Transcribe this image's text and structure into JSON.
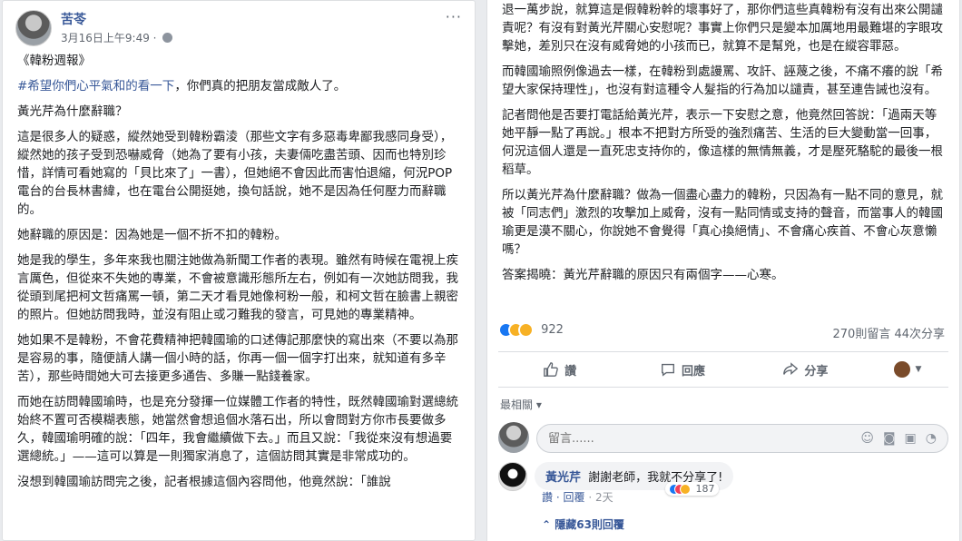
{
  "post": {
    "author": "苦苓",
    "time": "3月16日上午9:49 · ",
    "more": "···"
  },
  "left_paragraphs": [
    "《韓粉週報》",
    "黃光芹為什麼辭職？",
    "這是很多人的疑惑，縱然她受到韓粉霸淩（那些文字有多惡毒卑鄙我感同身受），縱然她的孩子受到恐嚇威脅（她為了要有小孩，夫妻倆吃盡苦頭、因而也特別珍惜，詳情可看她寫的「貝比來了」一書），但她絕不會因此而害怕退縮，何況POP電台的台長林書緯，也在電台公開挺她，換句話說，她不是因為任何壓力而辭職的。",
    "她辭職的原因是：因為她是一個不折不扣的韓粉。",
    "她是我的學生，多年來我也關注她做為新聞工作者的表現。雖然有時候在電視上疾言厲色，但從來不失她的專業，不會被意識形態所左右，例如有一次她訪問我，我從頭到尾把柯文哲痛罵一頓，第二天才看見她像柯粉一般，和柯文哲在臉書上親密的照片。但她訪問我時，並沒有阻止或刁難我的發言，可見她的專業精神。",
    "她如果不是韓粉，不會花費精神把韓國瑜的口述傳記那麼快的寫出來（不要以為那是容易的事，隨便請人講一個小時的話，你再一個一個字打出來，就知道有多辛苦），那些時間她大可去接更多通告、多賺一點錢養家。",
    "而她在訪問韓國瑜時，也是充分發揮一位媒體工作者的特性，既然韓國瑜對選總統始終不置可否模糊表態，她當然會想追個水落石出，所以會問對方你市長要做多久，韓國瑜明確的說：「四年，我會繼續做下去。」而且又說：「我從來沒有想過要選總統。」——這可以算是一則獨家消息了，這個訪問其實是非常成功的。",
    "沒想到韓國瑜訪問完之後，記者根據這個內容問他，他竟然說：「誰說"
  ],
  "hashtag_line": {
    "tag": "#希望你們心平氣和的看一下",
    "rest": "，你們真的把朋友當成敵人了。"
  },
  "right_paragraphs": [
    "退一萬步說，就算這是假韓粉幹的壞事好了，那你們這些真韓粉有沒有出來公開譴責呢？有沒有對黃光芹關心安慰呢？事實上你們只是變本加厲地用最難堪的字眼攻擊她，差別只在沒有威脅她的小孩而已，就算不是幫兇，也是在縱容罪惡。",
    "而韓國瑜照例像過去一樣，在韓粉到處謾罵、攻訐、誣蔑之後，不痛不癢的說「希望大家保持理性」，也沒有對這種令人髮指的行為加以譴責，甚至連告誡也沒有。",
    "記者問他是否要打電話給黃光芹，表示一下安慰之意，他竟然回答說：「過兩天等她平靜一點了再說。」根本不把對方所受的強烈痛苦、生活的巨大變動當一回事，何況這個人還是一直死忠支持你的，像這樣的無情無義，才是壓死駱駝的最後一根稻草。",
    "所以黃光芹為什麼辭職？做為一個盡心盡力的韓粉，只因為有一點不同的意見，就被「同志們」激烈的攻擊加上威脅，沒有一點同情或支持的聲音，而當事人的韓國瑜更是漠不關心，你說她不會覺得「真心換絕情」、不會痛心疾首、不會心灰意懶嗎？",
    "答案揭曉：黃光芹辭職的原因只有兩個字——心寒。"
  ],
  "stats": {
    "reactions_count": "922",
    "comments_shares": "270則留言 44次分享"
  },
  "actions": {
    "like": "讚",
    "comment": "回應",
    "share": "分享"
  },
  "sort_label": "最相關 ▾",
  "compose": {
    "placeholder": "留言......"
  },
  "comment": {
    "author": "黃光芹",
    "text": "謝謝老師，我就不分享了!",
    "reactions": "187",
    "like": "讚",
    "reply": "回覆",
    "time": "· 2天"
  },
  "hidden_replies": "隱藏63則回覆",
  "colors": {
    "link": "#385898",
    "like_blue": "#1877f2",
    "background": "#e9ebee"
  }
}
